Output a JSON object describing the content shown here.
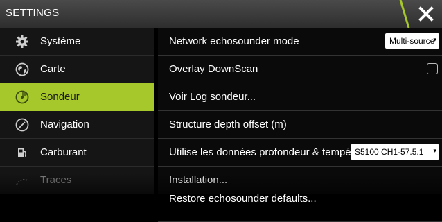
{
  "window": {
    "title": "SETTINGS"
  },
  "sidebar": {
    "items": [
      {
        "label": "Système",
        "icon": "gear-icon",
        "selected": false
      },
      {
        "label": "Carte",
        "icon": "globe-icon",
        "selected": false
      },
      {
        "label": "Sondeur",
        "icon": "sonar-icon",
        "selected": true
      },
      {
        "label": "Navigation",
        "icon": "compass-icon",
        "selected": false
      },
      {
        "label": "Carburant",
        "icon": "fuel-icon",
        "selected": false
      },
      {
        "label": "Traces",
        "icon": "tracks-icon",
        "selected": false
      }
    ]
  },
  "settings": {
    "network_mode": {
      "label": "Network echosounder mode",
      "value": "Multi-source"
    },
    "overlay": {
      "label": "Overlay DownScan"
    },
    "log": {
      "label": "Voir Log sondeur..."
    },
    "depth_offset": {
      "label": "Structure depth offset (m)"
    },
    "depth_temp": {
      "label": "Utilise les données profondeur & tempéra...",
      "value": "S5100 CH1-57.5.1"
    },
    "installation": {
      "label": "Installation..."
    },
    "restore": {
      "label": "Restore echosounder defaults..."
    }
  },
  "colors": {
    "accent": "#a6c82a",
    "background": "#000000",
    "sidebar": "#151515"
  }
}
